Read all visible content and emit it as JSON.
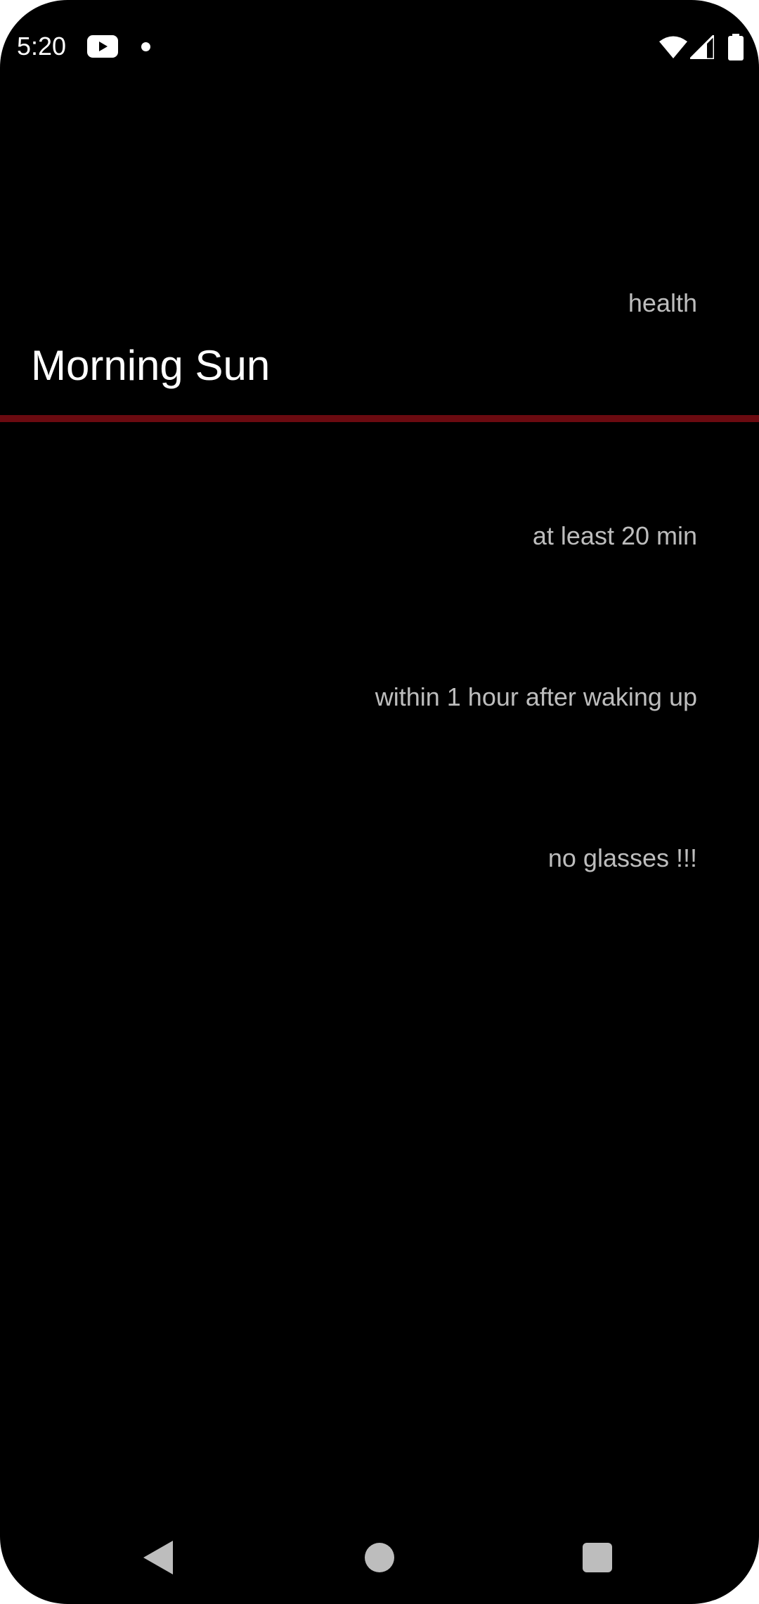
{
  "status_bar": {
    "time": "5:20",
    "icons": [
      "youtube-icon",
      "notification-dot-icon",
      "wifi-icon",
      "cellular-signal-icon",
      "battery-icon"
    ]
  },
  "task": {
    "category": "health",
    "title": "Morning Sun",
    "details": [
      "at least 20 min",
      "within 1 hour after waking up",
      "no glasses !!!"
    ]
  },
  "colors": {
    "background": "#000000",
    "accent_divider": "#6b0a10",
    "secondary_text": "#bdbdbd",
    "primary_text": "#ffffff"
  },
  "nav_bar": {
    "buttons": [
      "back-icon",
      "home-icon",
      "recents-icon"
    ]
  }
}
